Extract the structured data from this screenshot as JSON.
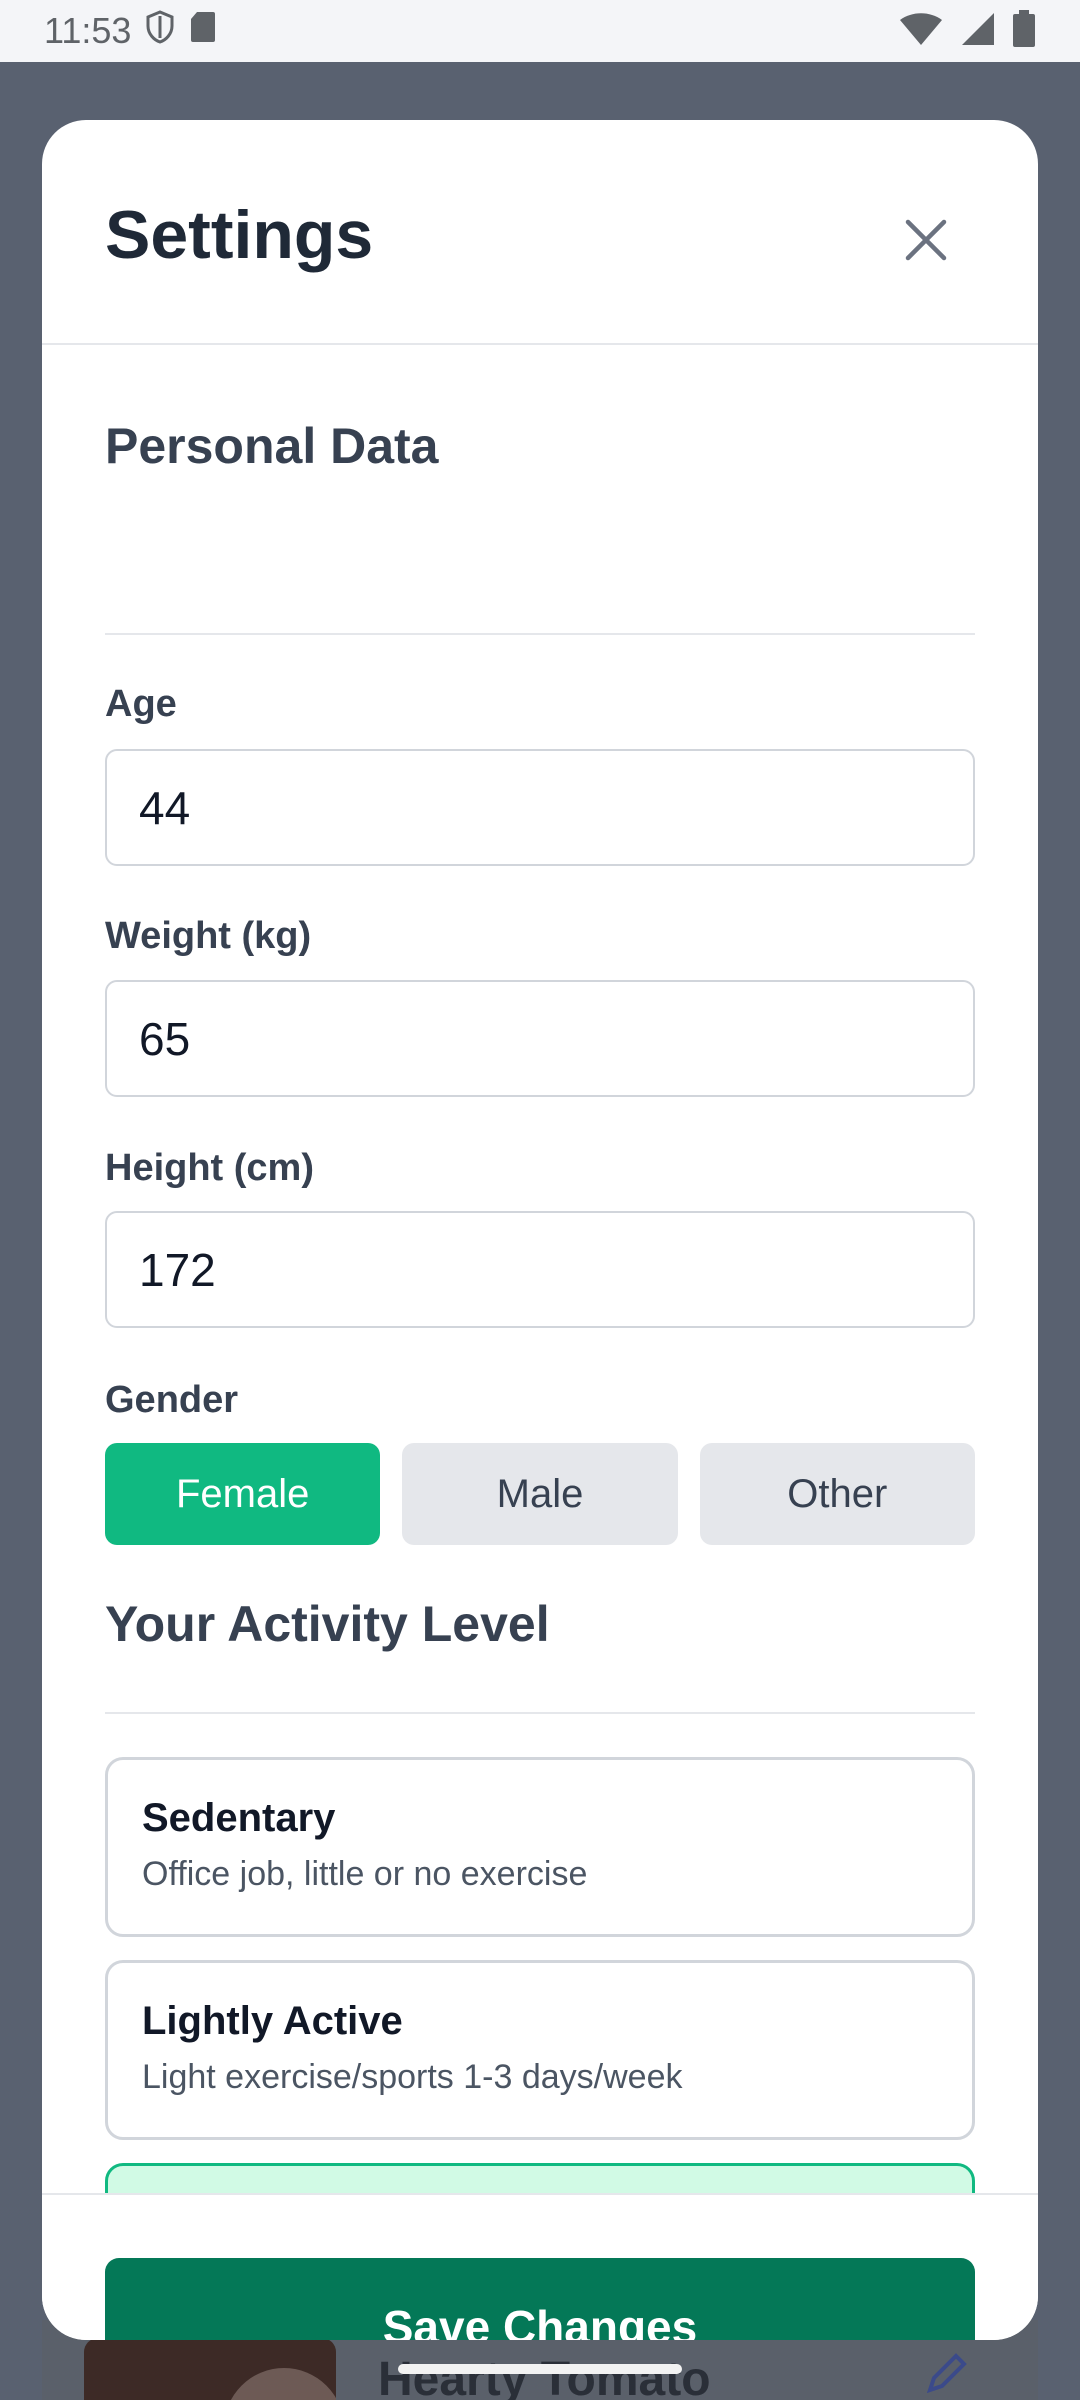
{
  "status_bar": {
    "time": "11:53"
  },
  "modal": {
    "title": "Settings",
    "personal_section_title": "Personal Data",
    "fields": {
      "age": {
        "label": "Age",
        "value": "44"
      },
      "weight": {
        "label": "Weight (kg)",
        "value": "65"
      },
      "height": {
        "label": "Height (cm)",
        "value": "172"
      }
    },
    "gender": {
      "label": "Gender",
      "options": [
        "Female",
        "Male",
        "Other"
      ],
      "selected": "Female"
    },
    "activity_section_title": "Your Activity Level",
    "activity_levels": [
      {
        "title": "Sedentary",
        "description": "Office job, little or no exercise"
      },
      {
        "title": "Lightly Active",
        "description": "Light exercise/sports 1-3 days/week"
      }
    ],
    "save_label": "Save Changes"
  },
  "background": {
    "card_title": "Hearty Tomato"
  },
  "colors": {
    "accent": "#10b981",
    "save_button": "#047857",
    "selected_card_bg": "#d1fae5"
  }
}
